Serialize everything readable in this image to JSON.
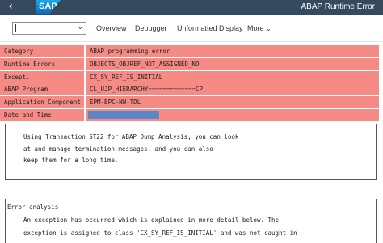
{
  "shell": {
    "back_glyph": "‹",
    "logo_text": "SAP",
    "title": "ABAP Runtime Error"
  },
  "toolbar": {
    "okcode_value": "",
    "buttons": [
      "Overview",
      "Debugger",
      "Unformatted Display",
      "More"
    ]
  },
  "info_rows": [
    {
      "label": "Category",
      "value": "ABAP programming error"
    },
    {
      "label": "Runtime Errors",
      "value": "OBJECTS_OBJREF_NOT_ASSIGNED_NO"
    },
    {
      "label": "Except.",
      "value": "CX_SY_REF_IS_INITIAL"
    },
    {
      "label": "ABAP Program",
      "value": "CL_UJP_HIERARCHY=============CP"
    },
    {
      "label": "Application Component",
      "value": "EPM-BPC-NW-TDL"
    },
    {
      "label": "Date and Time",
      "value": ""
    }
  ],
  "info_box": {
    "lines": [
      "Using Transaction ST22 for ABAP Dump Analysis, you can look",
      "at and manage termination messages, and you can also",
      "keep them for a long time."
    ]
  },
  "error_analysis": {
    "heading": "Error analysis",
    "lines": [
      "An exception has occurred which is explained in more detail below. The",
      "exception is assigned to class 'CX_SY_REF_IS_INITIAL' and was not caught in"
    ]
  },
  "colors": {
    "shell_bg": "#354a5f",
    "row_bg": "#f58b84",
    "redaction": "#5d86c7"
  },
  "icons": [
    "back-arrow-icon",
    "sap-logo",
    "dropdown-chevron-icon"
  ]
}
